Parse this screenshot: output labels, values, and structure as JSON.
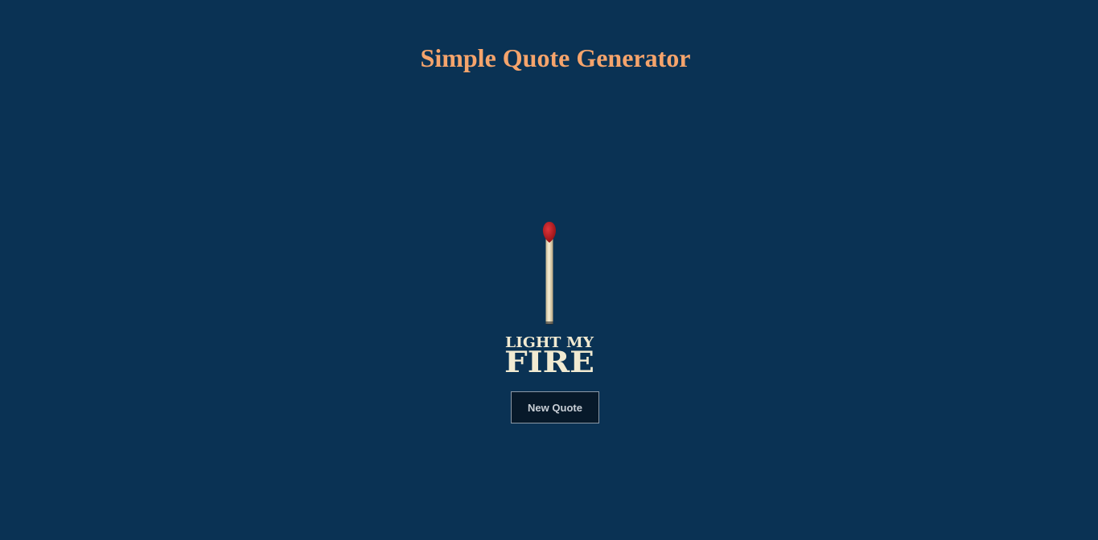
{
  "header": {
    "title": "Simple Quote Generator"
  },
  "logo": {
    "icon": "matchstick-icon",
    "line1": "LIGHT MY",
    "line2": "FIRE"
  },
  "actions": {
    "new_quote_label": "New Quote"
  },
  "colors": {
    "background": "#0a3254",
    "title": "#f5a46c",
    "match_head": "#b4161b",
    "match_stick": "#efe3c2",
    "logo_text": "#f1ead1",
    "button_bg": "#07192a",
    "button_border": "#8c98a6"
  }
}
